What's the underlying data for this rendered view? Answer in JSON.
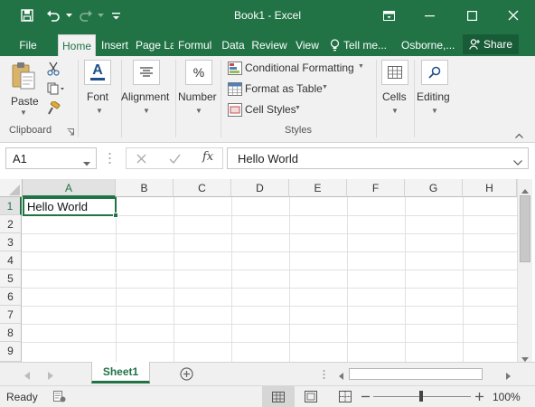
{
  "titlebar": {
    "title": "Book1 - Excel",
    "icons": [
      "save-icon",
      "undo-icon",
      "redo-icon",
      "customize-qat-icon",
      "ribbon-display-icon",
      "minimize-icon",
      "maximize-icon",
      "close-icon"
    ]
  },
  "tabs": {
    "file": "File",
    "home": "Home",
    "insert": "Insert",
    "page_layout": "Page La",
    "formulas": "Formul",
    "data": "Data",
    "review": "Review",
    "view": "View",
    "tell_me": "Tell me...",
    "user": "Osborne,...",
    "share": "Share"
  },
  "ribbon": {
    "clipboard": {
      "paste": "Paste",
      "group_label": "Clipboard"
    },
    "font": "Font",
    "alignment": "Alignment",
    "number": "Number",
    "number_symbol": "%",
    "styles": {
      "conditional_formatting": "Conditional Formatting",
      "format_as_table": "Format as Table",
      "cell_styles": "Cell Styles",
      "group_label": "Styles"
    },
    "cells": "Cells",
    "editing": "Editing",
    "font_icon_letter": "A"
  },
  "formula_bar": {
    "name_box": "A1",
    "fx_label": "fx",
    "value": "Hello World"
  },
  "sheet": {
    "columns": [
      "A",
      "B",
      "C",
      "D",
      "E",
      "F",
      "G",
      "H"
    ],
    "rows": [
      "1",
      "2",
      "3",
      "4",
      "5",
      "6",
      "7",
      "8",
      "9"
    ],
    "cell_a1": "Hello World",
    "selected_cell": "A1"
  },
  "sheet_tabs": {
    "active": "Sheet1"
  },
  "status": {
    "state": "Ready",
    "zoom": "100%"
  },
  "colors": {
    "accent": "#217346",
    "accent_dark": "#185c37",
    "ribbon_bg": "#f1f1f1"
  }
}
